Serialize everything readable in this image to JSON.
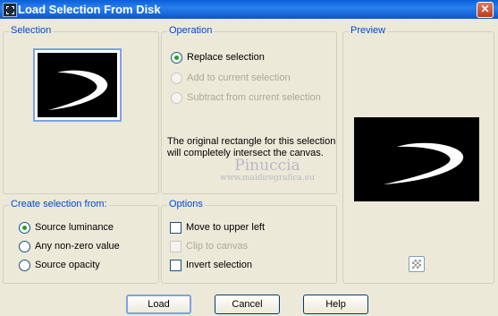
{
  "window": {
    "title": "Load Selection From Disk",
    "close_glyph": "✕"
  },
  "selection": {
    "label": "Selection"
  },
  "operation": {
    "label": "Operation",
    "options": [
      {
        "label": "Replace selection",
        "selected": true,
        "enabled": true
      },
      {
        "label": "Add to current selection",
        "selected": false,
        "enabled": false
      },
      {
        "label": "Subtract from current selection",
        "selected": false,
        "enabled": false
      }
    ],
    "info": "The original rectangle for this selection will completely intersect the canvas."
  },
  "preview": {
    "label": "Preview"
  },
  "create_from": {
    "label": "Create selection from:",
    "options": [
      {
        "label": "Source luminance",
        "selected": true
      },
      {
        "label": "Any non-zero value",
        "selected": false
      },
      {
        "label": "Source opacity",
        "selected": false
      }
    ]
  },
  "options": {
    "label": "Options",
    "items": [
      {
        "label": "Move to upper left",
        "checked": false,
        "enabled": true
      },
      {
        "label": "Clip to canvas",
        "checked": false,
        "enabled": false
      },
      {
        "label": "Invert selection",
        "checked": false,
        "enabled": true
      }
    ]
  },
  "watermark": {
    "line1": "Pinuccia",
    "line2": "www.maidiregrafica.eu"
  },
  "buttons": {
    "load": "Load",
    "cancel": "Cancel",
    "help": "Help"
  },
  "colors": {
    "title_bar": "#0a5fd8",
    "group_label": "#0046d5",
    "dialog_bg": "#ece9d8"
  }
}
